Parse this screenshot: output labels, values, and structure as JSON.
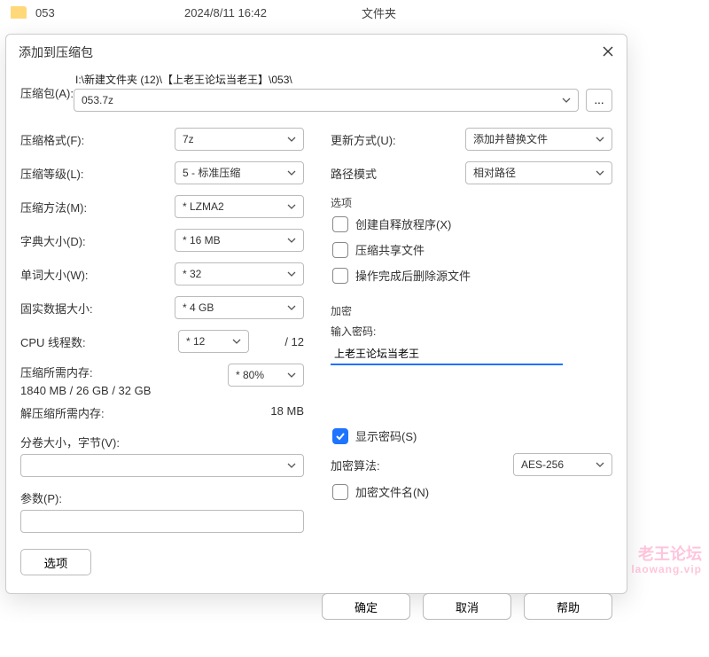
{
  "background_row": {
    "folder_name": "053",
    "date": "2024/8/11 16:42",
    "type": "文件夹"
  },
  "dialog": {
    "title": "添加到压缩包",
    "archive_label": "压缩包(A):",
    "archive_path": "I:\\新建文件夹 (12)\\【上老王论坛当老王】\\053\\",
    "archive_file": "053.7z",
    "browse": "...",
    "left": {
      "format_label": "压缩格式(F):",
      "format_value": "7z",
      "level_label": "压缩等级(L):",
      "level_value": "5 - 标准压缩",
      "method_label": "压缩方法(M):",
      "method_value": "* LZMA2",
      "dict_label": "字典大小(D):",
      "dict_value": "* 16 MB",
      "word_label": "单词大小(W):",
      "word_value": "* 32",
      "solid_label": "固实数据大小:",
      "solid_value": "* 4 GB",
      "threads_label": "CPU 线程数:",
      "threads_value": "* 12",
      "threads_max": "/ 12",
      "mem_comp_label": "压缩所需内存:",
      "mem_comp_percent": "* 80%",
      "mem_comp_value": "1840 MB / 26 GB / 32 GB",
      "mem_decomp_label": "解压缩所需内存:",
      "mem_decomp_value": "18 MB",
      "volume_label": "分卷大小，字节(V):",
      "params_label": "参数(P):",
      "options_btn": "选项"
    },
    "right": {
      "update_label": "更新方式(U):",
      "update_value": "添加并替换文件",
      "path_label": "路径模式",
      "path_value": "相对路径",
      "options_title": "选项",
      "sfx_label": "创建自释放程序(X)",
      "shared_label": "压缩共享文件",
      "delete_label": "操作完成后删除源文件",
      "encrypt_title": "加密",
      "pwd_label": "输入密码:",
      "pwd_value": "上老王论坛当老王",
      "show_pwd_label": "显示密码(S)",
      "enc_method_label": "加密算法:",
      "enc_method_value": "AES-256",
      "enc_names_label": "加密文件名(N)"
    },
    "footer": {
      "ok": "确定",
      "cancel": "取消",
      "help": "帮助"
    }
  },
  "watermark": {
    "l1": "老王论坛",
    "l2": "laowang.vip"
  }
}
